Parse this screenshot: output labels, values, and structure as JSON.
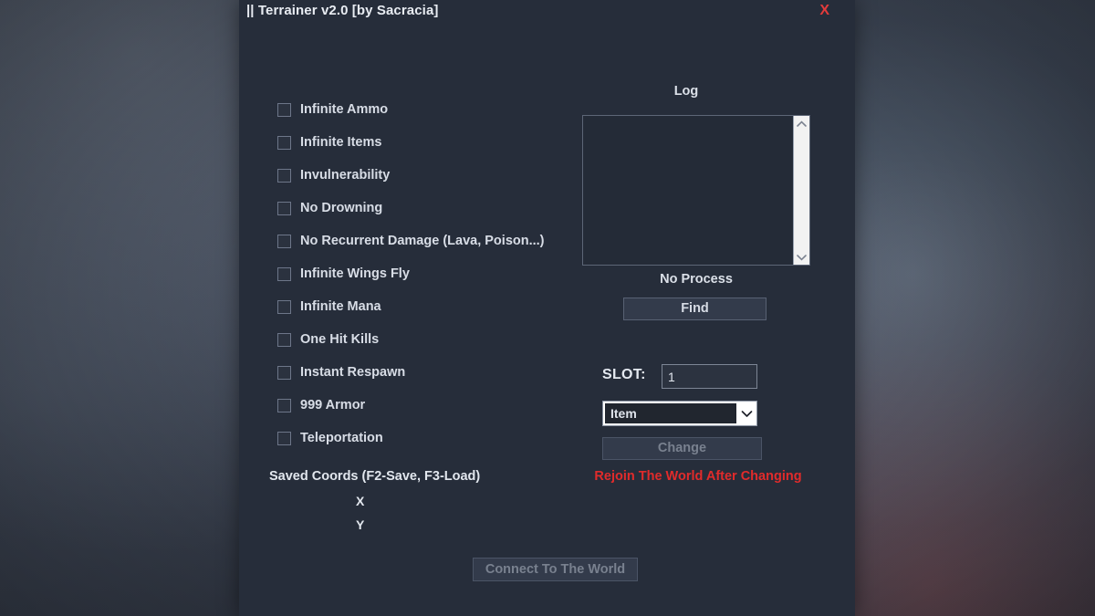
{
  "window": {
    "title": "|| Terrainer v2.0 [by Sacracia]",
    "close_label": "X",
    "close_color": "#e23b3b"
  },
  "cheats": {
    "items": [
      {
        "label": "Infinite Ammo",
        "checked": false
      },
      {
        "label": "Infinite Items",
        "checked": false
      },
      {
        "label": "Invulnerability",
        "checked": false
      },
      {
        "label": "No Drowning",
        "checked": false
      },
      {
        "label": "No Recurrent Damage (Lava, Poison...)",
        "checked": false
      },
      {
        "label": "Infinite Wings Fly",
        "checked": false
      },
      {
        "label": "Infinite Mana",
        "checked": false
      },
      {
        "label": "One Hit Kills",
        "checked": false
      },
      {
        "label": "Instant Respawn",
        "checked": false
      },
      {
        "label": "999 Armor",
        "checked": false
      },
      {
        "label": "Teleportation",
        "checked": false
      }
    ]
  },
  "coords": {
    "heading": "Saved Coords (F2-Save, F3-Load)",
    "x_label": "X",
    "y_label": "Y",
    "x_value": "",
    "y_value": ""
  },
  "log": {
    "title": "Log",
    "content": "",
    "scroll_up_icon": "chevron-up-icon",
    "scroll_down_icon": "chevron-down-icon"
  },
  "process": {
    "status": "No Process",
    "find_label": "Find"
  },
  "slot": {
    "label": "SLOT:",
    "value": "1",
    "placeholder": "",
    "dropdown_value": "Item",
    "dropdown_icon": "chevron-down-icon",
    "change_label": "Change",
    "change_disabled": true,
    "warning": "Rejoin The World After Changing",
    "warning_color": "#e12b2b"
  },
  "footer": {
    "connect_label": "Connect To The World",
    "connect_disabled": true
  }
}
